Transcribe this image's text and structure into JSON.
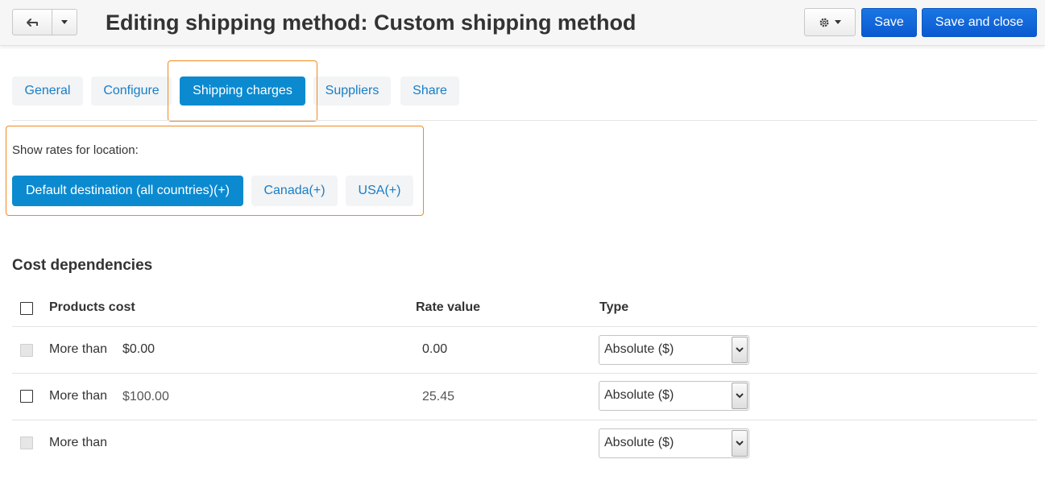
{
  "header": {
    "title": "Editing shipping method: Custom shipping method",
    "back_icon": "back-arrow-icon",
    "gear_icon": "gear-icon",
    "save_label": "Save",
    "save_close_label": "Save and close"
  },
  "tabs": [
    {
      "label": "General"
    },
    {
      "label": "Configure"
    },
    {
      "label": "Shipping charges",
      "active": true
    },
    {
      "label": "Suppliers"
    },
    {
      "label": "Share"
    }
  ],
  "location": {
    "label": "Show rates for location:",
    "options": [
      {
        "label": "Default destination (all countries)(+)",
        "active": true
      },
      {
        "label": "Canada(+)"
      },
      {
        "label": "USA(+)"
      }
    ]
  },
  "cost": {
    "title": "Cost dependencies",
    "headers": {
      "products_cost": "Products cost",
      "rate_value": "Rate value",
      "type": "Type"
    },
    "rows": [
      {
        "label": "More than",
        "amount": "$0.00",
        "rate": "0.00",
        "type": "Absolute ($)",
        "checkbox_disabled": true
      },
      {
        "label": "More than",
        "amount": "$100.00",
        "rate": "25.45",
        "type": "Absolute ($)",
        "checkbox_disabled": false
      },
      {
        "label": "More than",
        "amount": "",
        "rate": "",
        "type": "Absolute ($)",
        "checkbox_disabled": true
      }
    ]
  },
  "colors": {
    "primary": "#0b8ad0",
    "save_button": "#1a76e3",
    "link": "#1a7dc6",
    "highlight": "#f08a1f"
  }
}
